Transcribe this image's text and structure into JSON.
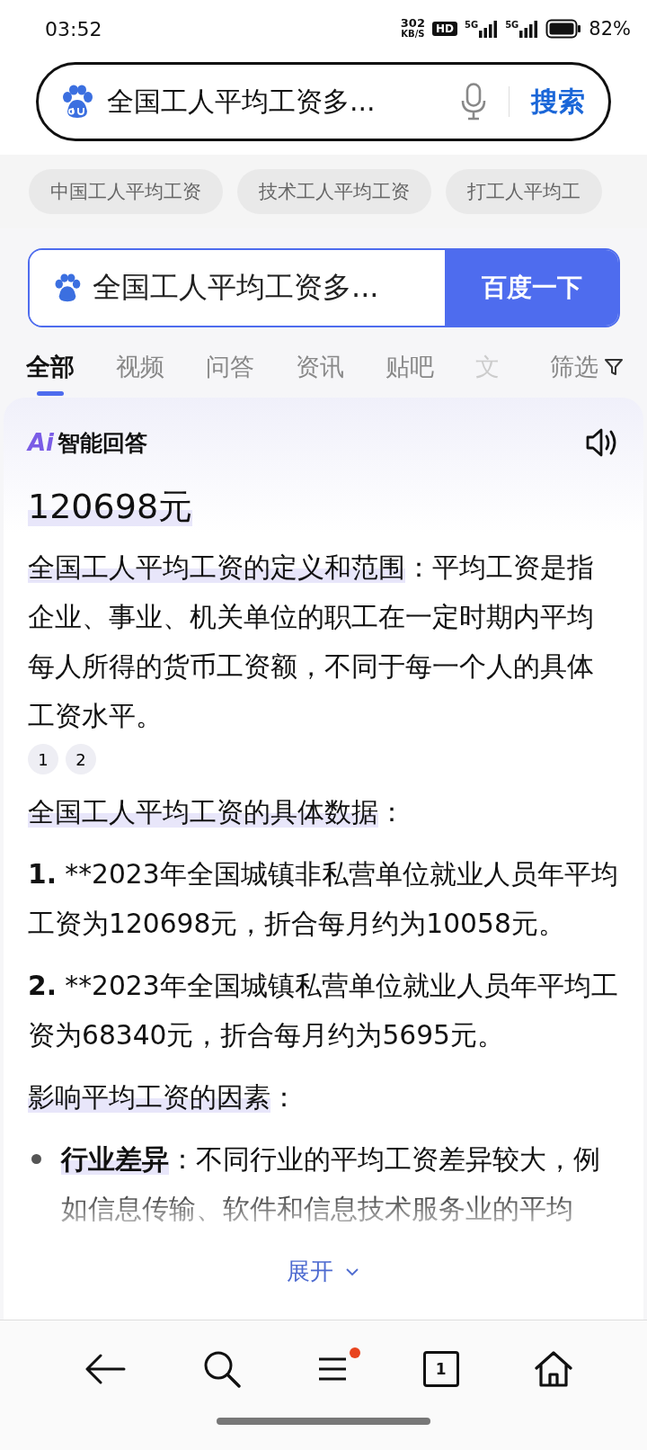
{
  "status_bar": {
    "time": "03:52",
    "speed_value": "302",
    "speed_unit": "KB/S",
    "hd_label": "HD",
    "signals": [
      {
        "label": "5G"
      },
      {
        "label": "5G"
      }
    ],
    "battery": "82%"
  },
  "top_search": {
    "query": "全国工人平均工资多...",
    "button": "搜索"
  },
  "related": [
    "中国工人平均工资",
    "技术工人平均工资",
    "打工人平均工"
  ],
  "search": {
    "query": "全国工人平均工资多...",
    "button": "百度一下"
  },
  "tabs": [
    {
      "label": "全部",
      "selected": true
    },
    {
      "label": "视频",
      "selected": false
    },
    {
      "label": "问答",
      "selected": false
    },
    {
      "label": "资讯",
      "selected": false
    },
    {
      "label": "贴吧",
      "selected": false
    },
    {
      "label": "文",
      "selected": false
    }
  ],
  "filter": "筛选",
  "answer": {
    "badge": "Ai",
    "title": "智能回答",
    "headline": "120698元",
    "sections": [
      {
        "kind": "paragraph",
        "text": "**全国工人平均工资的定义和范围**：平均工资是指企业、事业、机关单位的职工在一定时期内平均每人所得的货币工资额，不同于每一个人的具体工资水平。",
        "citations": [
          "1",
          "2"
        ]
      },
      {
        "kind": "heading",
        "text": "全国工人平均工资的具体数据："
      },
      {
        "kind": "numbered",
        "number": "1.",
        "text": "**2023年全国城镇非私营单位就业人员年平均工资为120698元，折合每月约为10058元。"
      },
      {
        "kind": "numbered",
        "number": "2.",
        "text": "**2023年全国城镇私营单位就业人员年平均工资为68340元，折合每月约为5695元。"
      },
      {
        "kind": "heading",
        "text": "影响平均工资的因素："
      },
      {
        "kind": "bullet",
        "text": "**行业差异**：不同行业的平均工资差异较大，例如信息传输、软件和信息技术服务业的平均"
      }
    ],
    "expand": "展开"
  },
  "bottom_nav": {
    "tab_count": "1",
    "menu_badge": true
  }
}
